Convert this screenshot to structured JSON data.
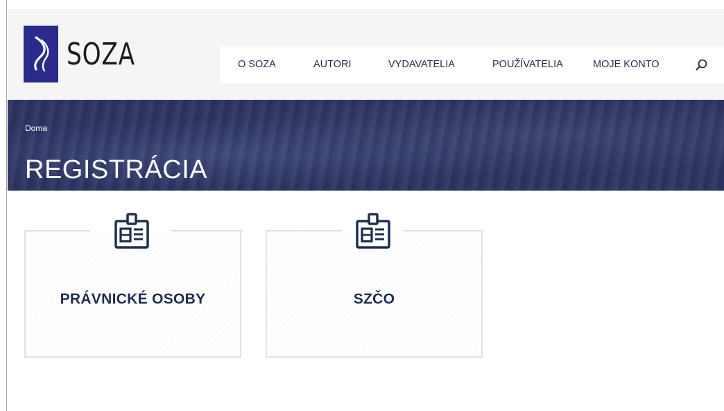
{
  "logo": {
    "text": "SOZA"
  },
  "nav": {
    "items": [
      {
        "label": "O SOZA"
      },
      {
        "label": "AUTORI"
      },
      {
        "label": "VYDAVATELIA"
      },
      {
        "label": "POUŽÍVATELIA"
      },
      {
        "label": "MOJE KONTO"
      }
    ],
    "search_icon": "search-icon"
  },
  "banner": {
    "breadcrumb": "Doma",
    "title": "REGISTRÁCIA"
  },
  "cards": [
    {
      "label": "PRÁVNICKÉ OSOBY",
      "icon": "id-badge-icon"
    },
    {
      "label": "SZČO",
      "icon": "id-badge-icon"
    }
  ],
  "colors": {
    "brand": "#2a2b8d",
    "text": "#1f2d4d",
    "banner": "#2b3260",
    "card_border": "#dbe2ec"
  }
}
